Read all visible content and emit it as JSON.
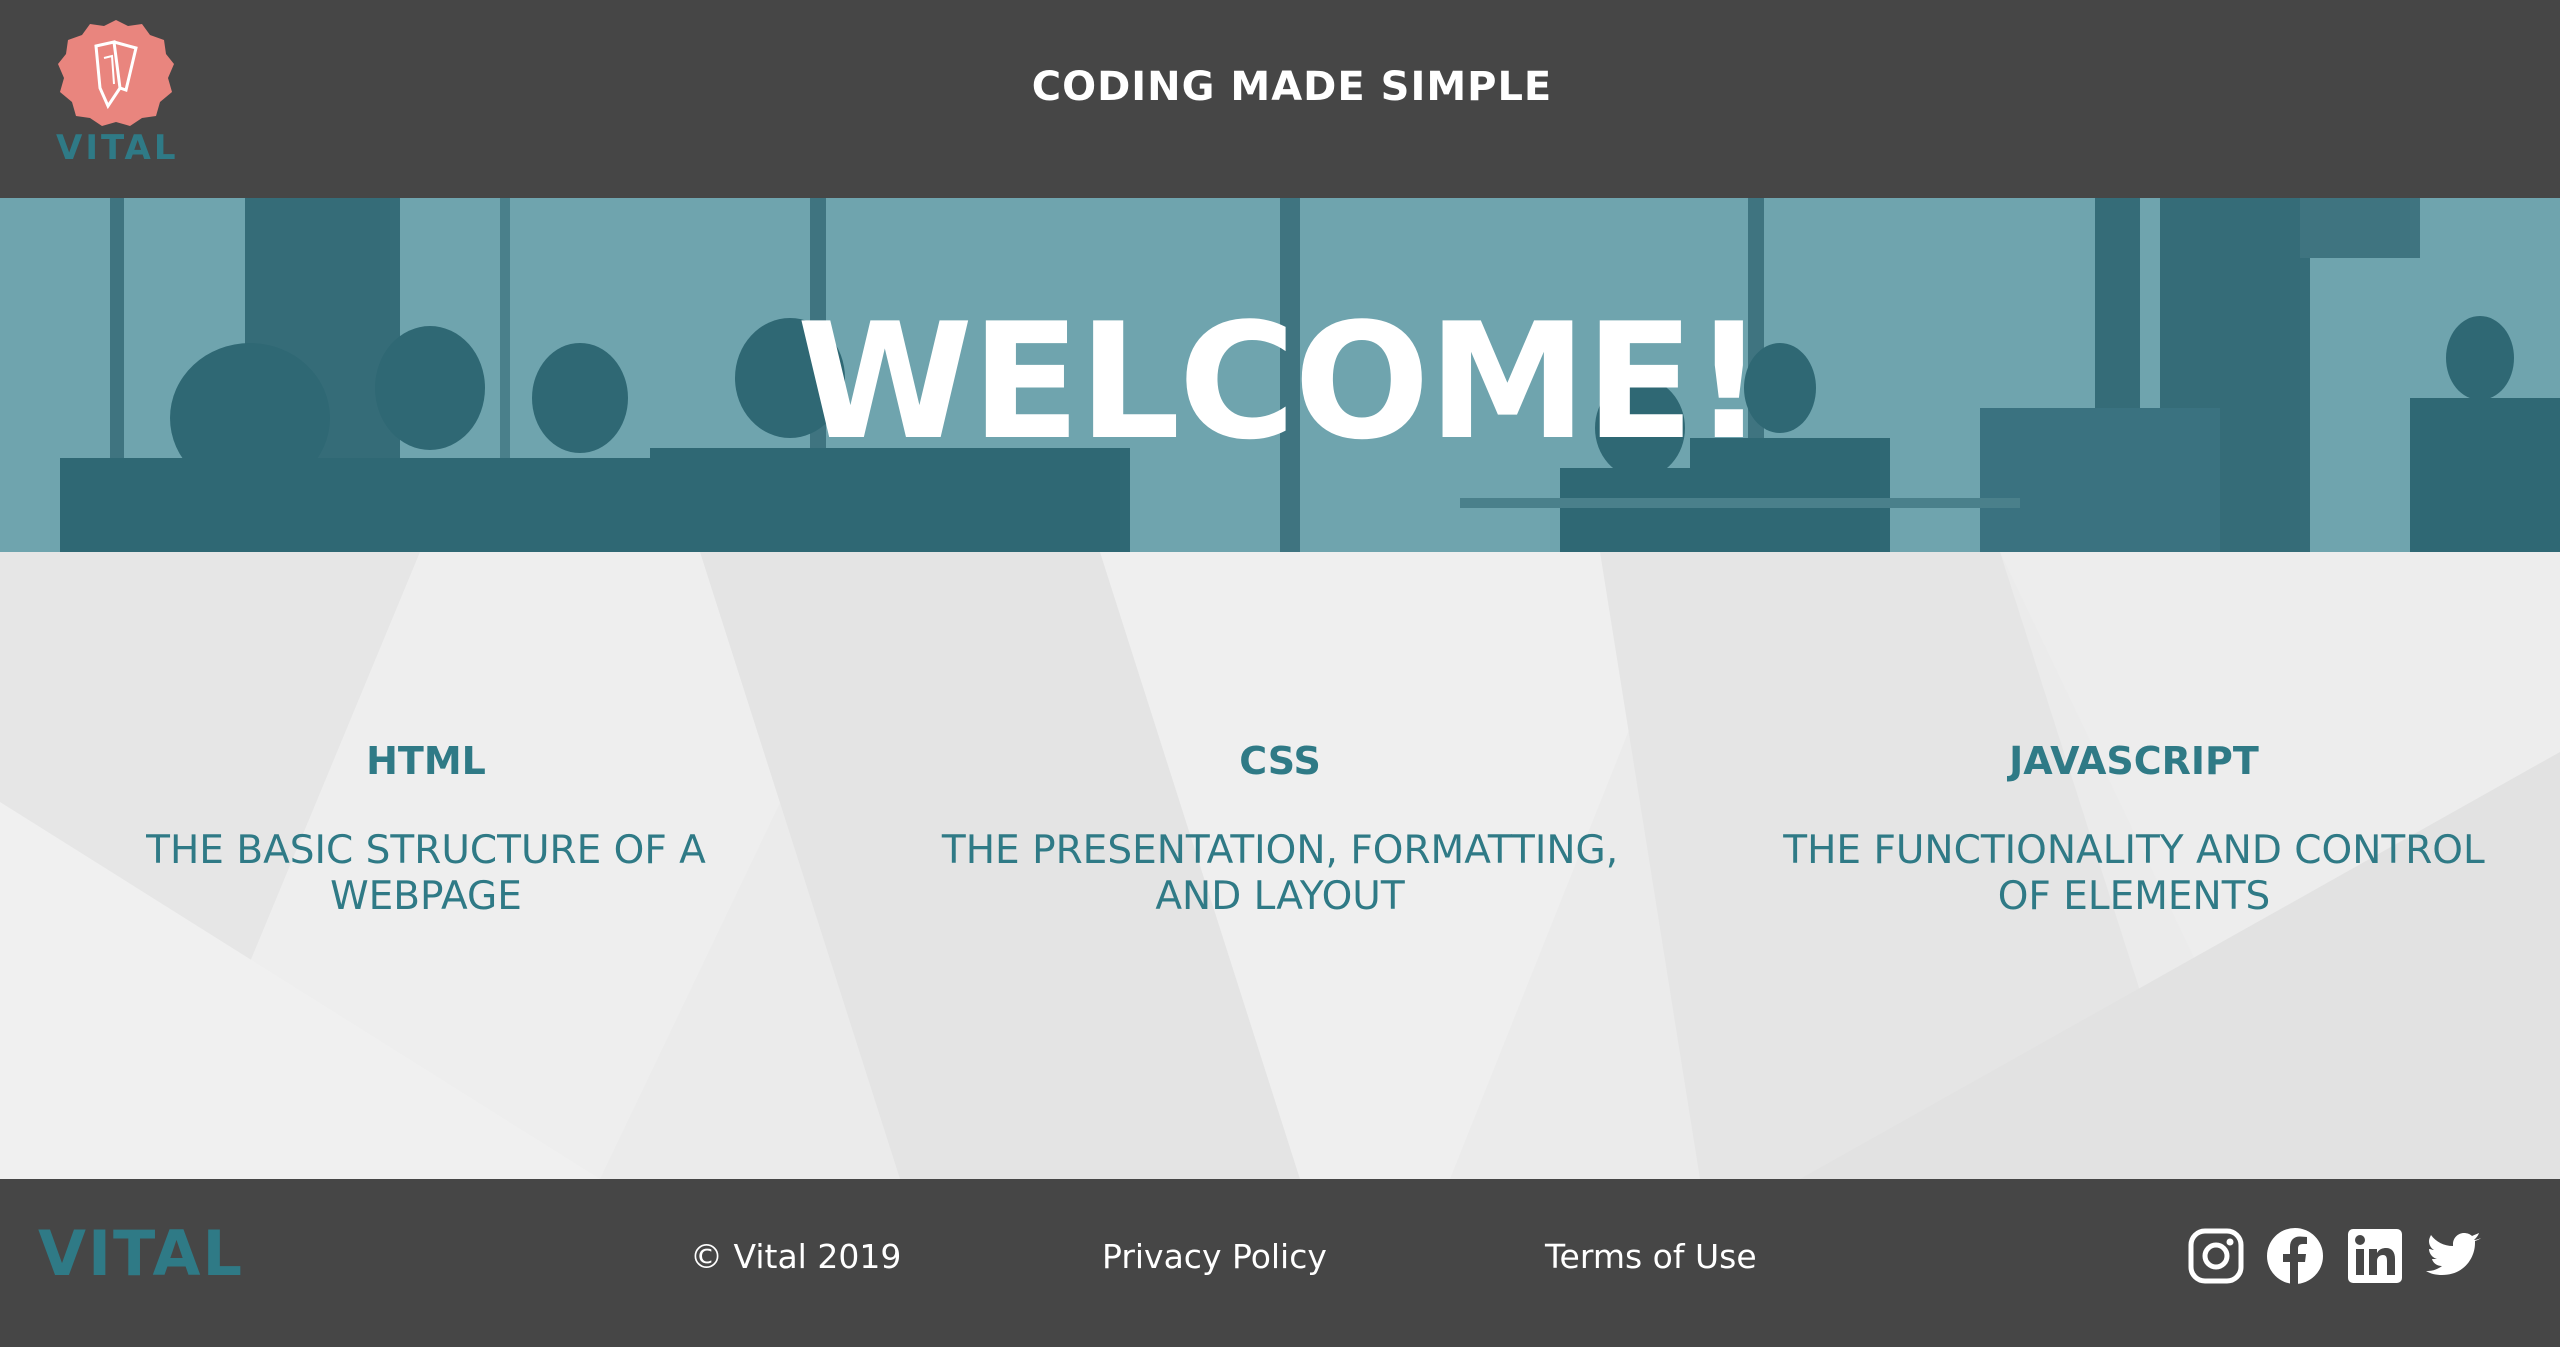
{
  "header": {
    "logo_text": "VITAL",
    "tagline": "CODING MADE SIMPLE"
  },
  "hero": {
    "title": "WELCOME!"
  },
  "columns": [
    {
      "title": "HTML",
      "description": "THE BASIC STRUCTURE OF A WEBPAGE"
    },
    {
      "title": "CSS",
      "description": "THE PRESENTATION, FORMATTING, AND LAYOUT"
    },
    {
      "title": "JAVASCRIPT",
      "description": "THE FUNCTIONALITY AND CONTROL OF ELEMENTS"
    }
  ],
  "footer": {
    "logo_text": "VITAL",
    "copyright": "© Vital 2019",
    "privacy": "Privacy Policy",
    "terms": "Terms of Use",
    "social_icons": [
      "instagram-icon",
      "facebook-icon",
      "linkedin-icon",
      "twitter-icon"
    ]
  },
  "colors": {
    "header_bg": "#464646",
    "accent_teal": "#2f7a86",
    "hero_bg": "#6fa4ae",
    "logo_coral": "#e9857e",
    "content_bg": "#ebebeb"
  }
}
